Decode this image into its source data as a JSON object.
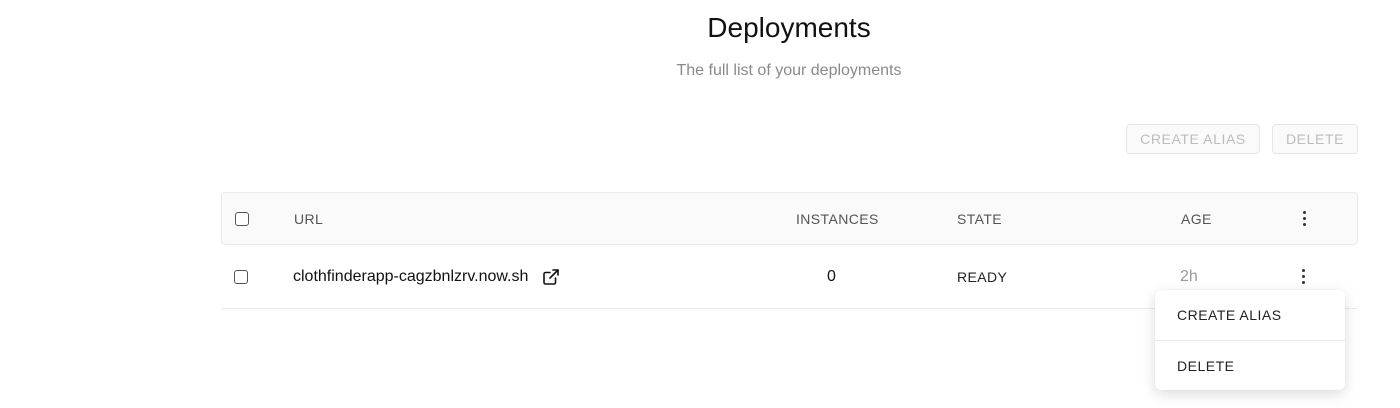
{
  "header": {
    "title": "Deployments",
    "subtitle": "The full list of your deployments"
  },
  "toolbar": {
    "create_alias_label": "CREATE ALIAS",
    "delete_label": "DELETE"
  },
  "table": {
    "columns": {
      "url": "URL",
      "instances": "INSTANCES",
      "state": "STATE",
      "age": "AGE"
    },
    "rows": [
      {
        "url": "clothfinderapp-cagzbnlzrv.now.sh",
        "instances": "0",
        "state": "READY",
        "age": "2h"
      }
    ]
  },
  "context_menu": {
    "items": [
      {
        "label": "CREATE ALIAS"
      },
      {
        "label": "DELETE"
      }
    ]
  },
  "colors": {
    "muted_text": "#8a8a8a",
    "disabled_button_text": "#bdbdbd",
    "border": "#eaeaea",
    "header_bg": "#fafafa"
  },
  "icons": [
    "external-link-icon",
    "kebab-menu-icon",
    "checkbox"
  ]
}
